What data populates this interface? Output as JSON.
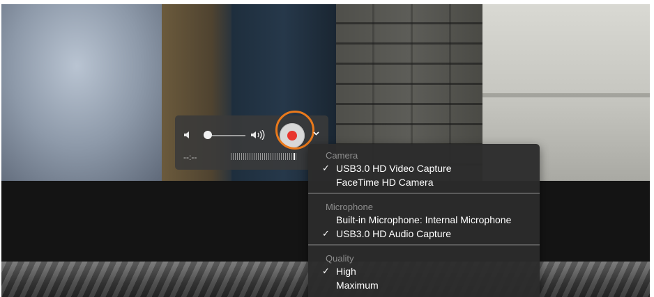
{
  "hud": {
    "volume_level": 0,
    "elapsed_time": "--:--",
    "icons": {
      "volume_low": "speaker-low-icon",
      "volume_high": "speaker-high-icon",
      "record": "record-icon",
      "options": "chevron-down-icon"
    },
    "colors": {
      "record_red": "#e8352d",
      "highlight_orange": "#e9791b"
    }
  },
  "menu": {
    "sections": [
      {
        "title": "Camera",
        "items": [
          {
            "label": "USB3.0 HD Video Capture",
            "checked": true
          },
          {
            "label": "FaceTime HD Camera",
            "checked": false
          }
        ]
      },
      {
        "title": "Microphone",
        "items": [
          {
            "label": "Built-in Microphone: Internal Microphone",
            "checked": false
          },
          {
            "label": "USB3.0 HD Audio Capture",
            "checked": true
          }
        ]
      },
      {
        "title": "Quality",
        "items": [
          {
            "label": "High",
            "checked": true
          },
          {
            "label": "Maximum",
            "checked": false
          }
        ]
      }
    ],
    "check_glyph": "✓"
  }
}
